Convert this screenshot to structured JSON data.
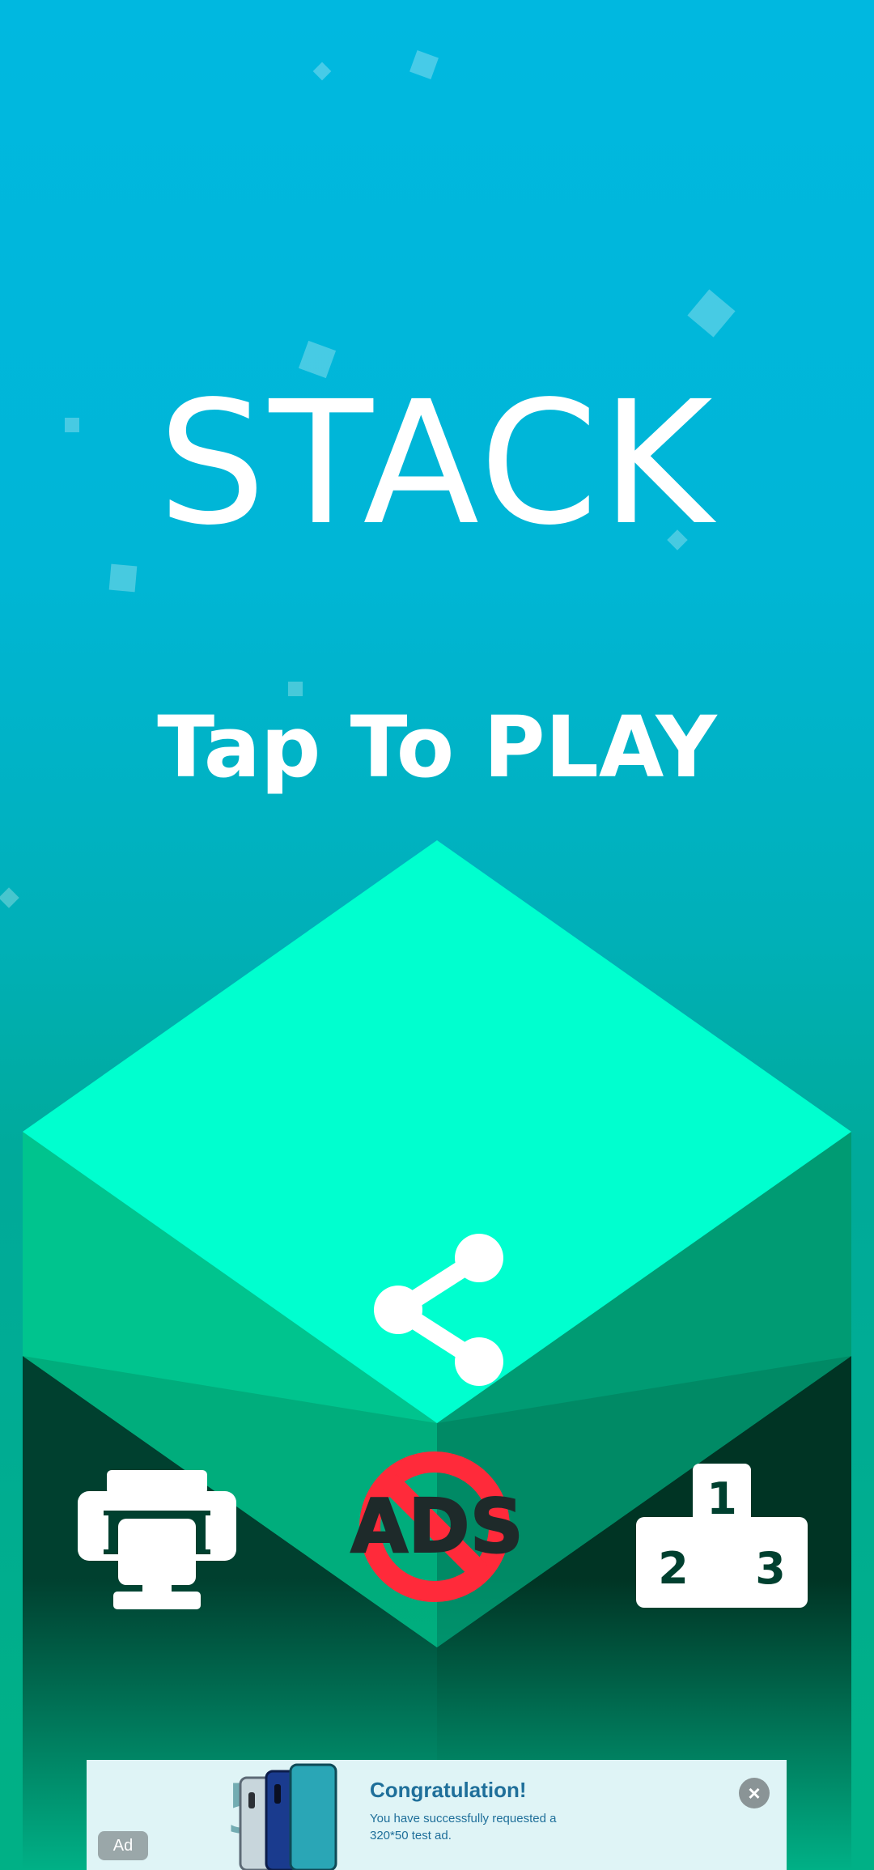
{
  "game": {
    "title": "STACK",
    "prompt": "Tap To PLAY"
  },
  "buttons": {
    "share_icon": "share-icon",
    "trophy_icon": "trophy-icon",
    "no_ads_icon": "no-ads-icon",
    "no_ads_label": "ADS",
    "leaderboard_icon": "podium-icon",
    "podium_first": "1",
    "podium_second": "2",
    "podium_third": "3"
  },
  "ad": {
    "title": "Congratulation!",
    "text": "You have successfully requested a 320*50 test ad.",
    "badge": "Ad",
    "close_icon": "close-icon",
    "promo_mark": "5G"
  },
  "colors": {
    "sky_top": "#00b8e0",
    "cube_top": "#00ffcf",
    "cube_left": "#00c48e",
    "cube_right": "#009b73",
    "cube_dark": "#00402f",
    "no_ads_red": "#ff2a3a"
  }
}
